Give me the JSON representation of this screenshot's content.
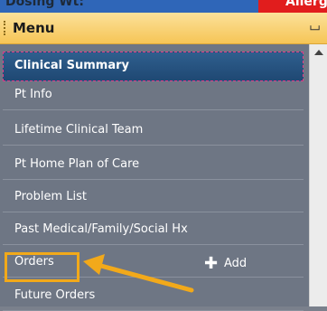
{
  "top_strip": {
    "left_text": "Dosing Wt:",
    "right_text": "Allerg"
  },
  "menu": {
    "title": "Menu",
    "pin_glyph": "⌴",
    "items": [
      {
        "label": "Clinical Summary",
        "selected": true
      },
      {
        "label": "Pt Info"
      },
      {
        "label": "Lifetime Clinical Team"
      },
      {
        "label": "Pt Home Plan of Care"
      },
      {
        "label": "Problem List"
      },
      {
        "label": "Past Medical/Family/Social Hx"
      },
      {
        "label": "Orders",
        "highlighted": true
      },
      {
        "label": "Future Orders"
      }
    ],
    "add_label": "Add",
    "add_icon": "plus-icon"
  },
  "colors": {
    "header": "#f6c556",
    "panel": "#6e7684",
    "selected": "#2f5f8e",
    "highlight": "#f2a91a",
    "allergy": "#e11d1d"
  }
}
